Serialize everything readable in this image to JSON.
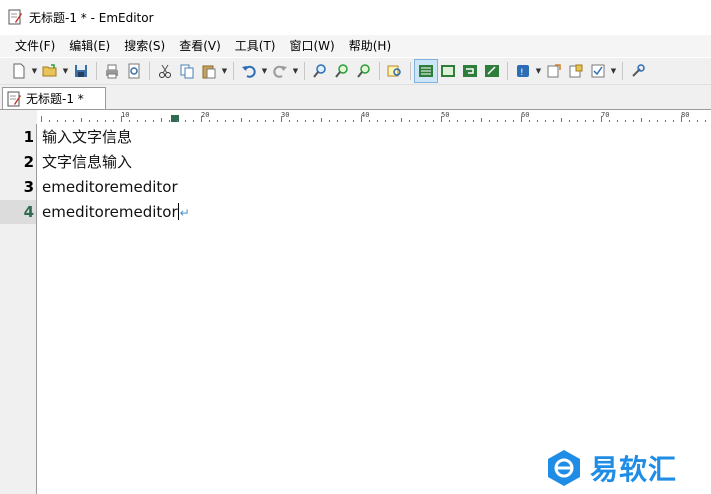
{
  "window": {
    "title": "无标题-1 * - EmEditor"
  },
  "menu": [
    "文件(F)",
    "编辑(E)",
    "搜索(S)",
    "查看(V)",
    "工具(T)",
    "窗口(W)",
    "帮助(H)"
  ],
  "toolbar": {
    "buttons": [
      "new-document-icon",
      "open-folder-icon",
      "save-icon",
      "print-icon",
      "print-preview-icon",
      "cut-icon",
      "copy-icon",
      "paste-icon",
      "undo-icon",
      "redo-icon",
      "find-icon",
      "find-next-icon",
      "find-previous-icon",
      "highlight-icon",
      "wrap-none-icon",
      "wrap-window-icon",
      "wrap-column-icon",
      "wrap-page-icon",
      "encoding-icon",
      "macro-icon",
      "plugin-icon",
      "customize-icon",
      "tools-icon"
    ]
  },
  "tab": {
    "label": "无标题-1 *"
  },
  "ruler": {
    "labels": [
      "10",
      "20",
      "30",
      "40",
      "50",
      "60",
      "70",
      "80"
    ]
  },
  "editor": {
    "lines": [
      {
        "number": "1",
        "text": "输入文字信息"
      },
      {
        "number": "2",
        "text": "文字信息输入"
      },
      {
        "number": "3",
        "text": "emeditoremeditor"
      },
      {
        "number": "4",
        "text": "emeditoremeditor"
      }
    ],
    "current_line": 4,
    "eol_mark": "↵"
  },
  "watermark": {
    "text": "易软汇"
  },
  "colors": {
    "accent": "#1f8ce6",
    "line_number_current": "#2f6b4f",
    "eol": "#4a8fd0"
  }
}
